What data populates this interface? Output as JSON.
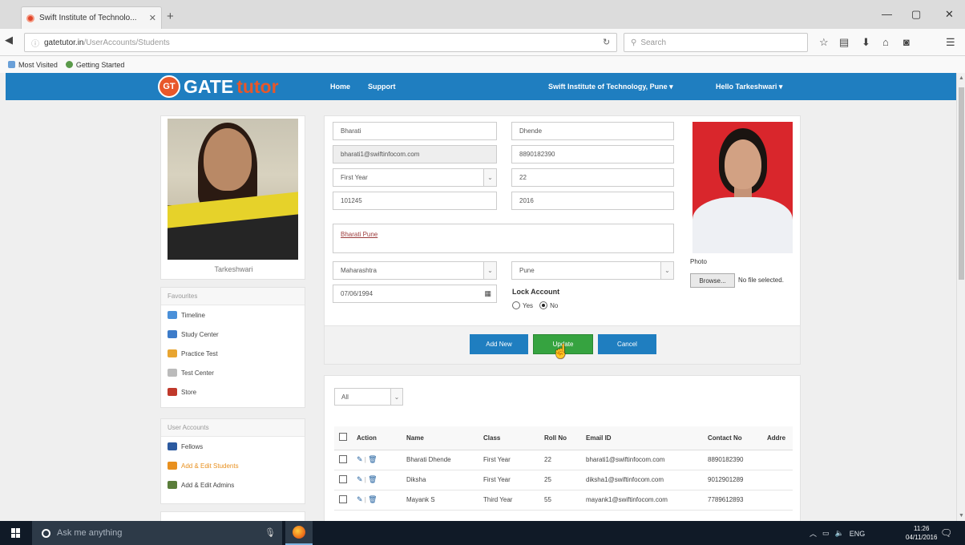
{
  "browser": {
    "tab_title": "Swift Institute of Technolo...",
    "url_host": "gatetutor.in",
    "url_path": "/UserAccounts/Students",
    "search_placeholder": "Search",
    "bookmarks": [
      "Most Visited",
      "Getting Started"
    ]
  },
  "header": {
    "logo_badge": "GT",
    "logo_gate": "GATE",
    "logo_tutor": "tutor",
    "nav": [
      "Home",
      "Support"
    ],
    "institute": "Swift Institute of Technology, Pune",
    "greeting": "Hello Tarkeshwari"
  },
  "profile": {
    "name": "Tarkeshwari"
  },
  "favourites": {
    "title": "Favourites",
    "items": [
      {
        "label": "Timeline",
        "icon": "timeline-icon",
        "color": "#4a90d9"
      },
      {
        "label": "Study Center",
        "icon": "study-center-icon",
        "color": "#3d7cc9"
      },
      {
        "label": "Practice Test",
        "icon": "practice-test-icon",
        "color": "#e8a531"
      },
      {
        "label": "Test Center",
        "icon": "test-center-icon",
        "color": "#bbbbbb"
      },
      {
        "label": "Store",
        "icon": "store-icon",
        "color": "#c0392b"
      }
    ]
  },
  "user_accounts": {
    "title": "User Accounts",
    "items": [
      {
        "label": "Fellows",
        "icon": "fellows-icon",
        "color": "#2c5aa0",
        "active": false
      },
      {
        "label": "Add & Edit Students",
        "icon": "add-students-icon",
        "color": "#e8901f",
        "active": true
      },
      {
        "label": "Add & Edit Admins",
        "icon": "add-admins-icon",
        "color": "#5a7d3a",
        "active": false
      }
    ]
  },
  "form": {
    "first_name": "Bharati",
    "last_name": "Dhende",
    "email": "bharati1@swiftinfocom.com",
    "contact": "8890182390",
    "class": "First Year",
    "roll_no": "22",
    "id_no": "101245",
    "year": "2016",
    "address": "Bharati Pune",
    "state": "Maharashtra",
    "city": "Pune",
    "dob": "07/06/1994",
    "lock_account_label": "Lock Account",
    "lock_yes": "Yes",
    "lock_no": "No",
    "lock_value": "No",
    "photo_label": "Photo",
    "browse_label": "Browse...",
    "no_file": "No file selected."
  },
  "buttons": {
    "add_new": "Add New",
    "update": "Update",
    "cancel": "Cancel"
  },
  "table": {
    "filter_value": "All",
    "columns": [
      "Action",
      "Name",
      "Class",
      "Roll No",
      "Email ID",
      "Contact No",
      "Addre"
    ],
    "rows": [
      {
        "name": "Bharati Dhende",
        "class": "First Year",
        "roll": "22",
        "email": "bharati1@swiftinfocom.com",
        "contact": "8890182390"
      },
      {
        "name": "Diksha",
        "class": "First Year",
        "roll": "25",
        "email": "diksha1@swiftinfocom.com",
        "contact": "9012901289"
      },
      {
        "name": "Mayank S",
        "class": "Third Year",
        "roll": "55",
        "email": "mayank1@swiftinfocom.com",
        "contact": "7789612893"
      }
    ]
  },
  "taskbar": {
    "search_placeholder": "Ask me anything",
    "lang": "ENG",
    "time": "11:26",
    "date": "04/11/2016"
  }
}
